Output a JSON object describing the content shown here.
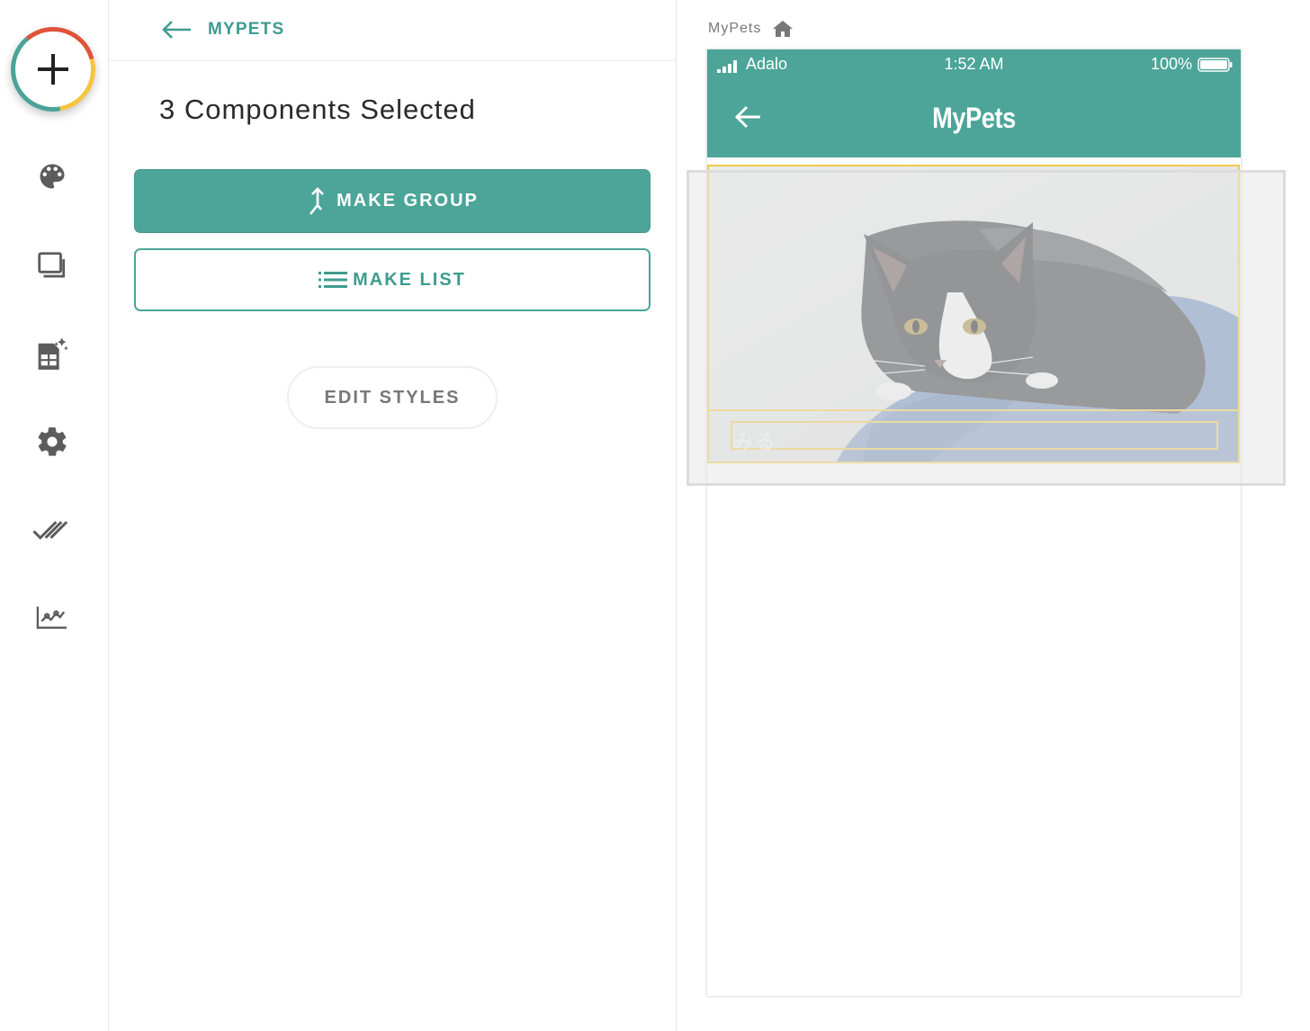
{
  "sidebar": {
    "add_icon": "plus-icon",
    "items": [
      {
        "name": "palette-icon"
      },
      {
        "name": "screens-icon"
      },
      {
        "name": "database-icon"
      },
      {
        "name": "gear-icon"
      },
      {
        "name": "checklist-icon"
      },
      {
        "name": "analytics-icon"
      }
    ],
    "accent_colors": [
      "#4aa396",
      "#e0523a",
      "#f5c542"
    ]
  },
  "panel": {
    "back_label": "MYPETS",
    "title": "3 Components Selected",
    "make_group_label": "MAKE GROUP",
    "make_list_label": "MAKE LIST",
    "edit_styles_label": "EDIT STYLES"
  },
  "canvas": {
    "breadcrumb": "MyPets",
    "breadcrumb_icon": "home-icon"
  },
  "phone": {
    "carrier": "Adalo",
    "time": "1:52 AM",
    "battery": "100%",
    "title": "MyPets",
    "text_value": "みる"
  },
  "colors": {
    "brand": "#4ca598",
    "selection": "#f2c94c"
  }
}
